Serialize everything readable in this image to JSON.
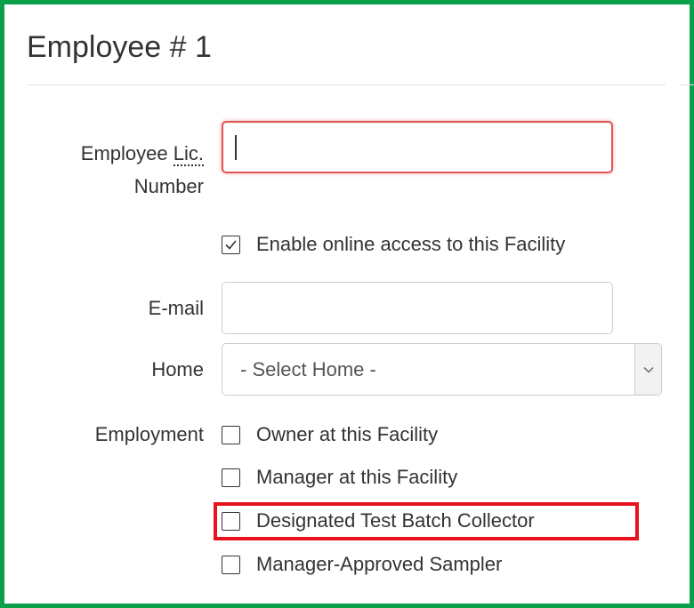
{
  "form": {
    "title": "Employee # 1",
    "license": {
      "label_abbr": "Lic.",
      "label_prefix": "Employee",
      "label_suffix": "Number",
      "value": ""
    },
    "online_access": {
      "label": "Enable online access to this Facility",
      "checked": true
    },
    "email": {
      "label": "E-mail",
      "value": ""
    },
    "home": {
      "label": "Home",
      "selected": "- Select Home -"
    },
    "employment": {
      "label": "Employment",
      "options": [
        {
          "label": "Owner at this Facility",
          "checked": false
        },
        {
          "label": "Manager at this Facility",
          "checked": false
        },
        {
          "label": "Designated Test Batch Collector",
          "checked": false,
          "highlighted": true
        },
        {
          "label": "Manager-Approved Sampler",
          "checked": false
        }
      ]
    }
  },
  "colors": {
    "frame": "#0aa04a",
    "highlight": "#e8121c",
    "error_border": "#e05555",
    "text": "#333333"
  }
}
